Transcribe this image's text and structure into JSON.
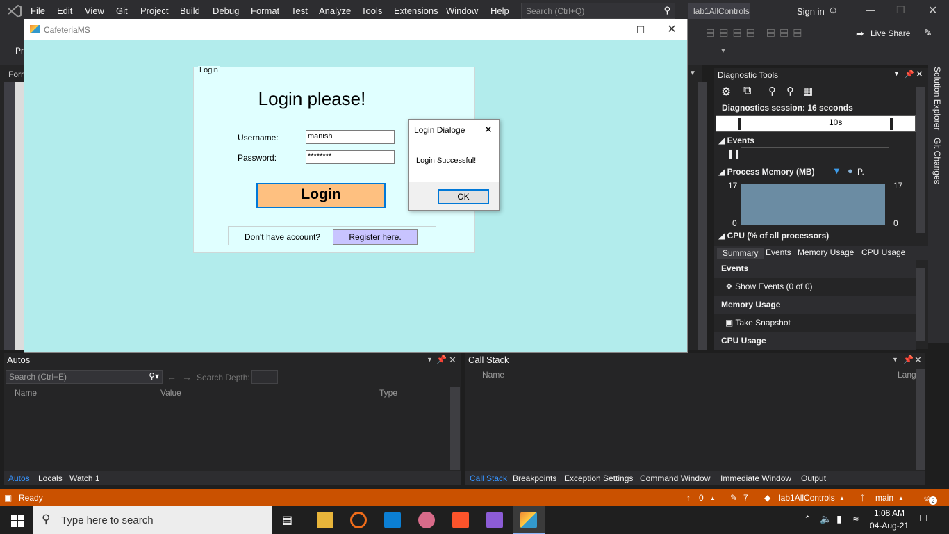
{
  "menu": {
    "items": [
      "File",
      "Edit",
      "View",
      "Git",
      "Project",
      "Build",
      "Debug",
      "Format",
      "Test",
      "Analyze",
      "Tools",
      "Extensions",
      "Window",
      "Help"
    ],
    "search_placeholder": "Search (Ctrl+Q)",
    "solution_name": "lab1AllControls",
    "sign_in": "Sign in",
    "live_share": "Live Share"
  },
  "toolbar": {
    "left_partial": "Pr",
    "form_tab_partial": "Forr"
  },
  "app_window": {
    "title": "CafeteriaMS",
    "group_label": "Login",
    "heading": "Login please!",
    "username_label": "Username:",
    "username_value": "manish",
    "password_label": "Password:",
    "password_value": "********",
    "login_button": "Login",
    "no_account_text": "Don't have account?",
    "register_button": "Register here."
  },
  "dialog": {
    "title": "Login Dialoge",
    "message": "Login Successful!",
    "ok_button": "OK"
  },
  "diagnostics": {
    "title": "Diagnostic Tools",
    "session": "Diagnostics session: 16 seconds",
    "ruler_label": "10s",
    "events_section": "Events",
    "memory_section": "Process Memory (MB)",
    "memory_legend": "P.",
    "mem_max_left": "17",
    "mem_min_left": "0",
    "mem_max_right": "17",
    "mem_min_right": "0",
    "cpu_section": "CPU (% of all processors)",
    "tabs": [
      "Summary",
      "Events",
      "Memory Usage",
      "CPU Usage"
    ],
    "summary_events_head": "Events",
    "show_events": "Show Events (0 of 0)",
    "summary_memory_head": "Memory Usage",
    "take_snapshot": "Take Snapshot",
    "summary_cpu_head": "CPU Usage"
  },
  "side_tabs": [
    "Solution Explorer",
    "Git Changes"
  ],
  "autos": {
    "title": "Autos",
    "search_placeholder": "Search (Ctrl+E)",
    "search_depth": "Search Depth:",
    "columns": [
      "Name",
      "Value",
      "Type"
    ],
    "tabs": [
      "Autos",
      "Locals",
      "Watch 1"
    ]
  },
  "callstack": {
    "title": "Call Stack",
    "columns": [
      "Name",
      "Lang"
    ],
    "tabs": [
      "Call Stack",
      "Breakpoints",
      "Exception Settings",
      "Command Window",
      "Immediate Window",
      "Output"
    ]
  },
  "statusbar": {
    "ready": "Ready",
    "up_count": "0",
    "edit_count": "7",
    "repo": "lab1AllControls",
    "branch": "main",
    "notifications": "2"
  },
  "taskbar": {
    "search_placeholder": "Type here to search",
    "time": "1:08 AM",
    "date": "04-Aug-21"
  },
  "colors": {
    "accent_orange": "#ca5100",
    "app_bg": "#b2ecec",
    "login_button": "#fec080",
    "register_button": "#c8c4ff"
  }
}
